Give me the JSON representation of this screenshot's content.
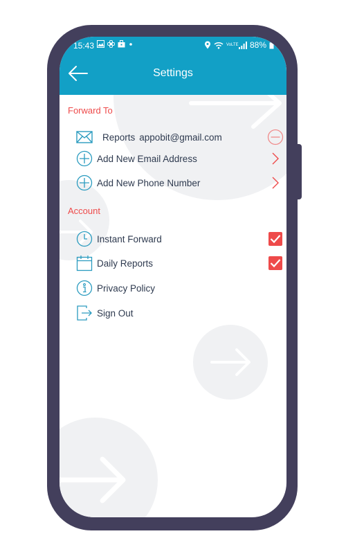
{
  "status_bar": {
    "time": "15:43",
    "battery": "88%",
    "network_label": "VoLTE"
  },
  "header": {
    "title": "Settings"
  },
  "forward_to": {
    "section_title": "Forward To",
    "email_entry": {
      "label": "Reports",
      "email": "appobit@gmail.com"
    },
    "add_email_label": "Add New Email Address",
    "add_phone_label": "Add New Phone Number"
  },
  "account": {
    "section_title": "Account",
    "instant_forward_label": "Instant Forward",
    "instant_forward_checked": true,
    "daily_reports_label": "Daily Reports",
    "daily_reports_checked": true,
    "privacy_policy_label": "Privacy Policy",
    "sign_out_label": "Sign Out"
  },
  "colors": {
    "header": "#12a0c6",
    "accent": "#ee4a4a",
    "text": "#2e3a4f",
    "icon": "#2a9bbf",
    "frame": "#433f5c"
  }
}
